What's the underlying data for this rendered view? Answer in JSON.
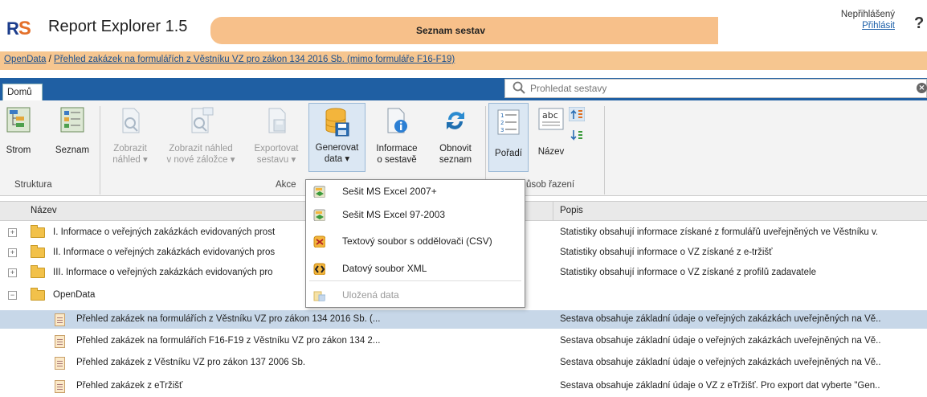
{
  "header": {
    "logo_r": "R",
    "logo_s": "S",
    "app_title": "Report Explorer 1.5",
    "page_heading": "Seznam sestav",
    "user_status": "Nepřihlášený",
    "login_label": "Přihlásit",
    "help_label": "?"
  },
  "breadcrumb": {
    "root": "OpenData",
    "separator": "/",
    "current": "Přehled zakázek na formulářích z Věstníku VZ pro zákon 134 2016 Sb. (mimo formuláře F16-F19)"
  },
  "tabs": {
    "home": "Domů"
  },
  "search": {
    "placeholder": "Prohledat sestavy",
    "clear": "×"
  },
  "ribbon": {
    "strom": "Strom",
    "seznam": "Seznam",
    "zobrazit_nahled_1": "Zobrazit",
    "zobrazit_nahled_2": "náhled ▾",
    "zobrazit_nahled_zalozka_1": "Zobrazit náhled",
    "zobrazit_nahled_zalozka_2": "v nové záložce ▾",
    "exportovat_1": "Exportovat",
    "exportovat_2": "sestavu ▾",
    "generovat_1": "Generovat",
    "generovat_2": "data ▾",
    "informace_1": "Informace",
    "informace_2": "o sestavě",
    "obnovit_1": "Obnovit",
    "obnovit_2": "seznam",
    "poradi": "Pořadí",
    "nazev": "Název",
    "group_struktura": "Struktura",
    "group_akce": "Akce",
    "group_razeni": "ůsob řazení"
  },
  "menu": {
    "items": [
      {
        "label": "Sešit MS Excel 2007+",
        "icon": "excel-icon",
        "enabled": true
      },
      {
        "label": "Sešit MS Excel 97-2003",
        "icon": "excel-icon",
        "enabled": true
      },
      {
        "label": "Textový soubor s oddělovači (CSV)",
        "icon": "csv-icon",
        "enabled": true
      },
      {
        "label": "Datový soubor XML",
        "icon": "xml-icon",
        "enabled": true
      },
      {
        "label": "Uložená data",
        "icon": "saved-data-icon",
        "enabled": false
      }
    ]
  },
  "grid": {
    "col_name": "Název",
    "col_desc": "Popis",
    "rows": [
      {
        "name": "I. Informace o veřejných zakázkách evidovaných prost",
        "desc": "Statistiky obsahují informace získané z formulářů uveřejněných ve Věstníku v.",
        "toggle": "+",
        "kind": "folder"
      },
      {
        "name": "II. Informace o veřejných zakázkách evidovaných pros",
        "desc": "Statistiky obsahují informace o VZ získané z e-tržišť",
        "toggle": "+",
        "kind": "folder"
      },
      {
        "name": "III. Informace o veřejných zakázkách evidovaných pro",
        "desc": "Statistiky obsahují informace o VZ získané z profilů zadavatele",
        "toggle": "+",
        "kind": "folder"
      },
      {
        "name": "OpenData",
        "desc": "",
        "toggle": "−",
        "kind": "folder"
      },
      {
        "name": "Přehled zakázek na formulářích z Věstníku VZ pro zákon 134 2016 Sb. (...",
        "desc": "Sestava obsahuje základní údaje o veřejných zakázkách uveřejněných na Vě..",
        "toggle": "",
        "kind": "doc",
        "selected": true
      },
      {
        "name": "Přehled zakázek na formulářích F16-F19 z Věstníku VZ pro zákon 134 2...",
        "desc": "Sestava obsahuje základní údaje o veřejných zakázkách uveřejněných na Vě..",
        "toggle": "",
        "kind": "doc"
      },
      {
        "name": "Přehled zakázek z Věstníku VZ pro zákon 137 2006 Sb.",
        "desc": "Sestava obsahuje základní údaje o veřejných zakázkách uveřejněných na Vě..",
        "toggle": "",
        "kind": "doc"
      },
      {
        "name": "Přehled zakázek z eTržišť",
        "desc": "Sestava obsahuje základní údaje o VZ z eTržišť. Pro export dat vyberte \"Gen..",
        "toggle": "",
        "kind": "doc"
      }
    ]
  },
  "colors": {
    "accent_orange": "#f7c08a",
    "tabbar_blue": "#1f5fa3",
    "selection": "#c7d7e8"
  }
}
